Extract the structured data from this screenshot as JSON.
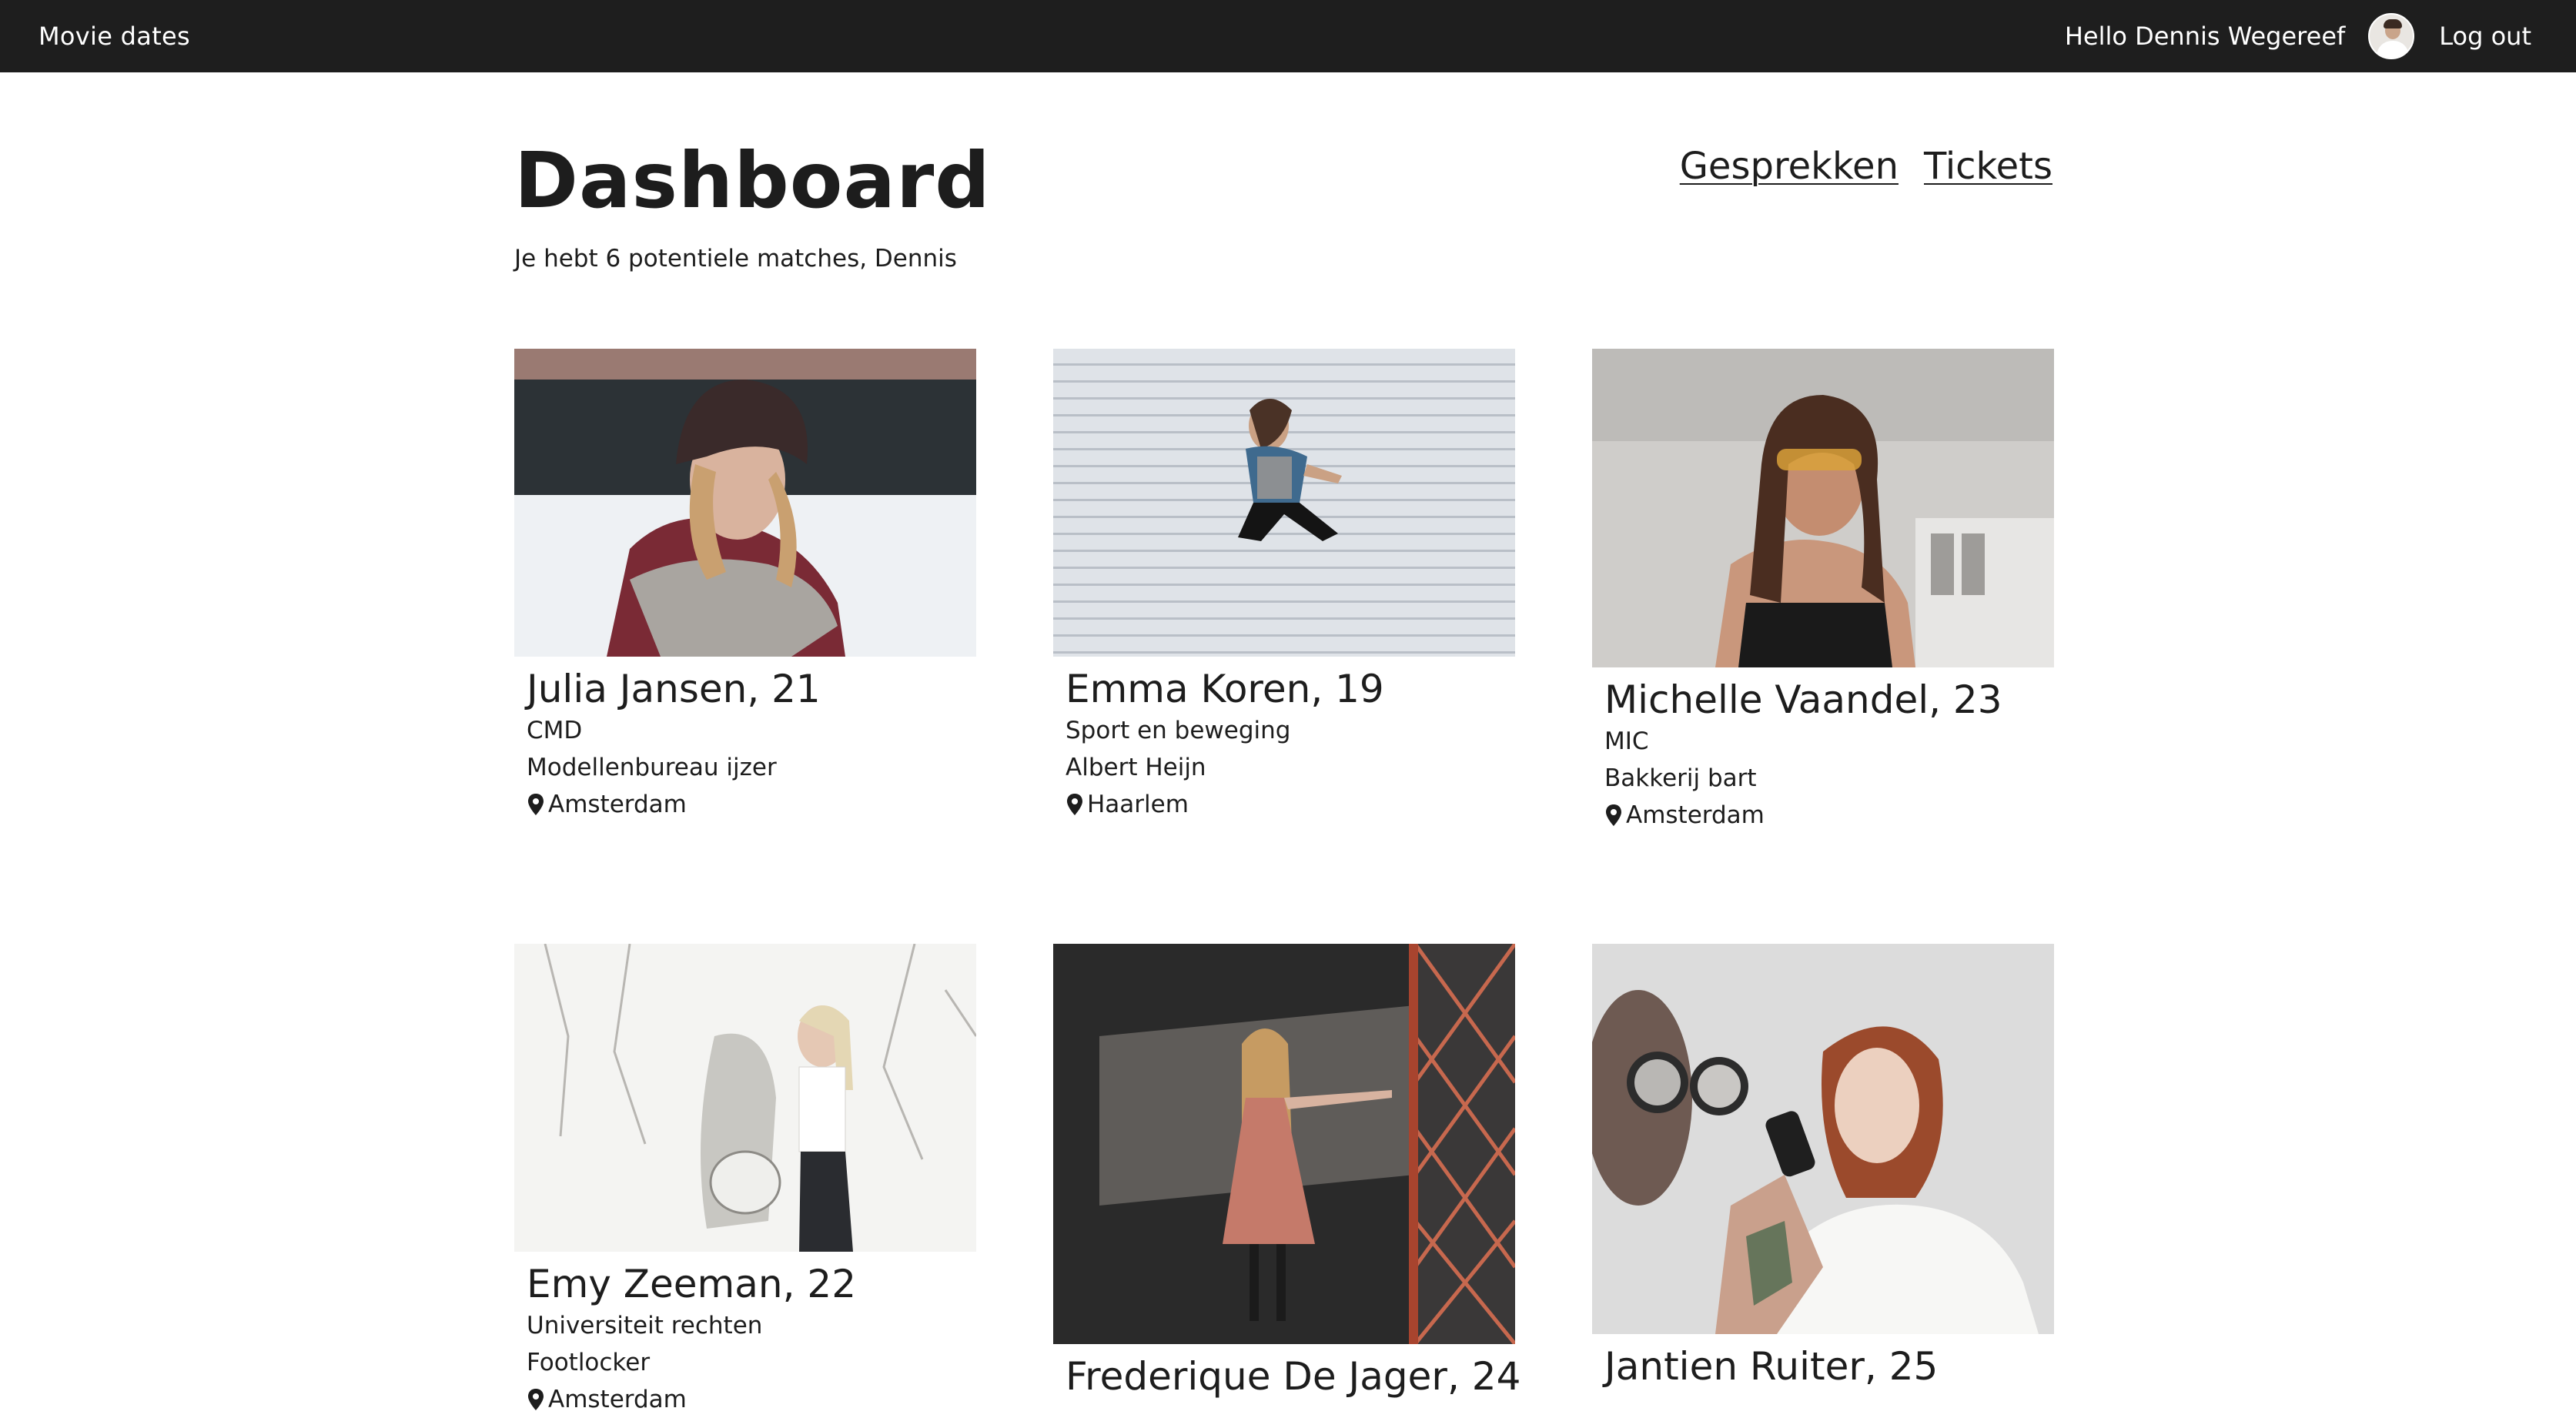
{
  "navbar": {
    "brand": "Movie dates",
    "greeting": "Hello Dennis Wegereef",
    "logout": "Log out"
  },
  "header": {
    "title": "Dashboard",
    "subtitle": "Je hebt 6 potentiele matches, Dennis",
    "links": [
      "Gesprekken",
      "Tickets"
    ]
  },
  "matches": [
    {
      "name": "Julia Jansen, 21",
      "study": "CMD",
      "work": "Modellenbureau ijzer",
      "city": "Amsterdam"
    },
    {
      "name": "Emma Koren, 19",
      "study": "Sport en beweging",
      "work": "Albert Heijn",
      "city": "Haarlem"
    },
    {
      "name": "Michelle Vaandel, 23",
      "study": "MIC",
      "work": "Bakkerij bart",
      "city": "Amsterdam"
    },
    {
      "name": "Emy Zeeman, 22",
      "study": "Universiteit rechten",
      "work": "Footlocker",
      "city": "Amsterdam"
    },
    {
      "name": "Frederique De Jager, 24"
    },
    {
      "name": "Jantien Ruiter, 25"
    }
  ],
  "colors": {
    "navbar_bg": "#1e1e1e",
    "text": "#1d1d1d"
  },
  "icons": {
    "location": "map-pin-icon",
    "avatar": "user-avatar"
  }
}
